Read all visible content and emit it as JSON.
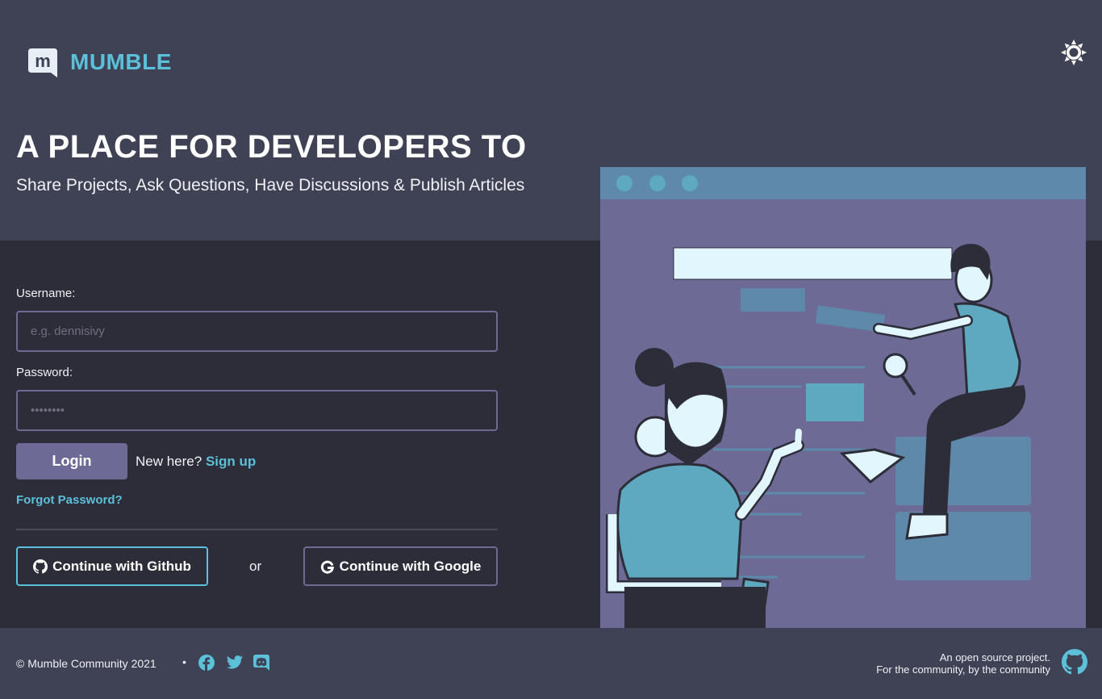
{
  "brand": {
    "name": "MUMBLE",
    "logo_letter": "m"
  },
  "header": {
    "title": "A PLACE FOR DEVELOPERS TO",
    "subtitle": "Share Projects, Ask Questions, Have Discussions & Publish Articles"
  },
  "form": {
    "username_label": "Username:",
    "username_placeholder": "e.g. dennisivy",
    "username_value": "",
    "password_label": "Password:",
    "password_placeholder": "••••••••",
    "password_value": "",
    "login_label": "Login",
    "new_here": "New here?",
    "signup_label": "Sign up",
    "forgot_label": "Forgot Password?",
    "github_label": "Continue with Github",
    "or_label": "or",
    "google_label": "Continue with Google"
  },
  "footer": {
    "copyright": "© Mumble Community 2021",
    "separator": "•",
    "social_icons": [
      "facebook-icon",
      "twitter-icon",
      "discord-icon"
    ],
    "oss_line1": "An open source project.",
    "oss_line2": "For the community, by the community"
  },
  "colors": {
    "background": "#3f4155",
    "panel": "#2d2d39",
    "accent": "#5bc0d8",
    "primary": "#6d6a96"
  }
}
